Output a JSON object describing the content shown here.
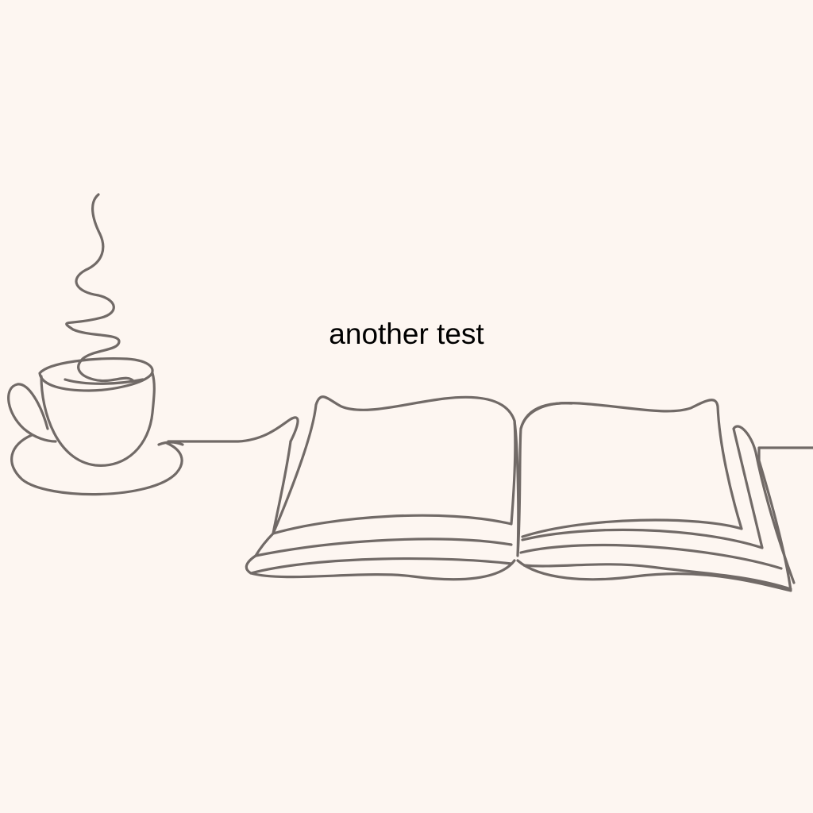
{
  "colors": {
    "background": "#fdf6f1",
    "line": "#716a67",
    "text": "#000000"
  },
  "caption": "another test",
  "illustration": {
    "style": "single continuous line drawing",
    "icons": [
      "coffee-cup-icon",
      "open-book-icon"
    ]
  }
}
